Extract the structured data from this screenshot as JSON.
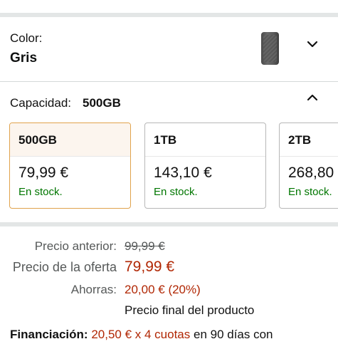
{
  "color": {
    "label": "Color:",
    "value": "Gris",
    "thumbnail_icon": "ssd-drive-thumbnail",
    "toggle_icon": "chevron-down-icon"
  },
  "capacity": {
    "label": "Capacidad:",
    "value": "500GB",
    "toggle_icon": "chevron-up-icon",
    "options": [
      {
        "size": "500GB",
        "price": "79,99 €",
        "stock": "En stock.",
        "selected": true
      },
      {
        "size": "1TB",
        "price": "143,10 €",
        "stock": "En stock.",
        "selected": false
      },
      {
        "size": "2TB",
        "price": "268,80",
        "stock": "En stock.",
        "selected": false
      }
    ]
  },
  "pricing": {
    "previous_label": "Precio anterior:",
    "previous_value": "99,99 €",
    "deal_label": "Precio de la oferta",
    "deal_value": "79,99 €",
    "savings_label": "Ahorras:",
    "savings_value": "20,00 € (20%)",
    "final_note": "Precio final del producto"
  },
  "financing": {
    "label": "Financiación:",
    "quota": "20,50 € x 4 cuotas",
    "suffix": "en 90 días con"
  },
  "colors": {
    "deal_red": "#b12704",
    "stock_green": "#007600",
    "selected_border": "#e0a24c",
    "separator": "#e3e6e6"
  }
}
